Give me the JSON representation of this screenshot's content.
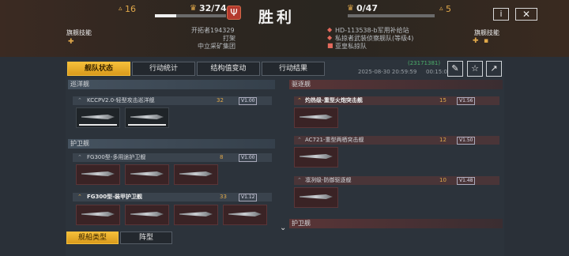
{
  "header": {
    "left_count": "16",
    "score": "32/74",
    "title": "胜利",
    "right_score": "0/47",
    "right_count": "5",
    "info_label": "i",
    "close_label": "✕"
  },
  "left_side": {
    "skill_label": "旗舰技能",
    "lines": [
      "开拓者194329",
      "打架",
      "中立采矿集团"
    ]
  },
  "right_side": {
    "skill_label": "旗舰技能",
    "lines": [
      "HD-113538-b军用补给站",
      "私掠者武装侦察舰队(等级4)",
      "亚皇私掠队"
    ]
  },
  "tabs": [
    "舰队状态",
    "行动统计",
    "结构值变动",
    "行动结果"
  ],
  "meta": {
    "tag": "(23171381)",
    "time": "2025-08-30 20:59:59",
    "duration": "00:15:01"
  },
  "left_panel": {
    "cruiser_header": "巡洋舰",
    "cruiser_row": {
      "name": "KCCPV2.0-轻型攻击巡洋舰",
      "count": "32",
      "level": "V1.00"
    },
    "escort_header": "护卫舰",
    "escort_row1": {
      "name": "FG300型-多用途护卫舰",
      "count": "8",
      "level": "V1.00"
    },
    "escort_row2": {
      "name": "FG300型-装甲护卫舰",
      "count": "33",
      "level": "V1.12"
    }
  },
  "right_panel": {
    "destroyer_header": "驱逐舰",
    "rows": [
      {
        "name": "灼热级-重型火炮突击舰",
        "count": "15",
        "level": "V1.56"
      },
      {
        "name": "AC721-重型两栖突击舰",
        "count": "12",
        "level": "V1.50"
      },
      {
        "name": "凛冽级-防御驱逐舰",
        "count": "10",
        "level": "V1.48"
      }
    ],
    "escort_header": "护卫舰"
  },
  "bottom_tabs": [
    "舰船类型",
    "阵型"
  ],
  "colors": {
    "accent": "#f5bf3a",
    "enemy": "#e36a5c",
    "brand": "#b43a2e"
  }
}
